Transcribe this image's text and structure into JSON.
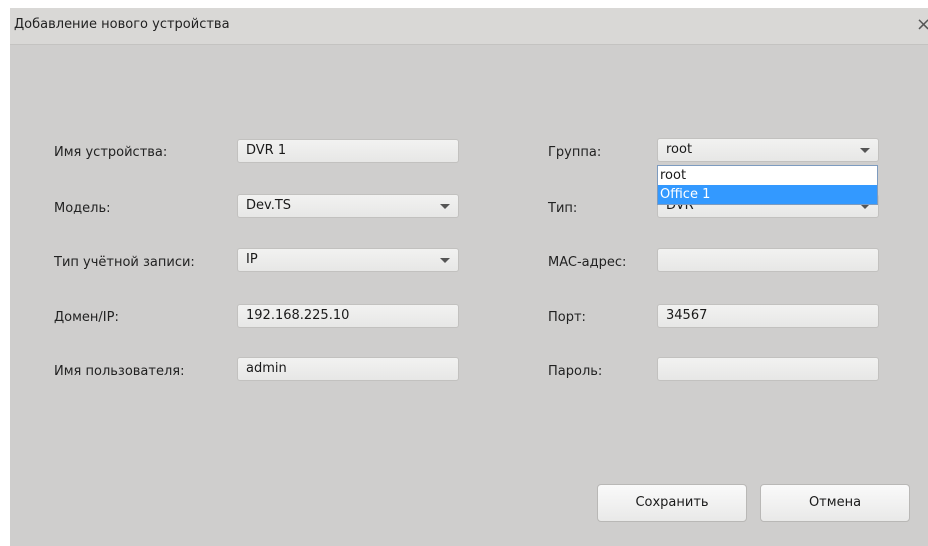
{
  "dialog": {
    "title": "Добавление нового устройства",
    "close_glyph": "×"
  },
  "left": {
    "device_name": {
      "label": "Имя устройства:",
      "value": "DVR 1"
    },
    "model": {
      "label": "Модель:",
      "value": "Dev.TS"
    },
    "account_type": {
      "label": "Тип учётной записи:",
      "value": "IP"
    },
    "domain_ip": {
      "label": "Домен/IP:",
      "value": "192.168.225.10"
    },
    "username": {
      "label": "Имя пользователя:",
      "value": "admin"
    }
  },
  "right": {
    "group": {
      "label": "Группа:",
      "value": "root",
      "options": [
        "root",
        "Office 1"
      ],
      "highlighted": "Office 1"
    },
    "type": {
      "label": "Тип:",
      "value": "DVR"
    },
    "mac": {
      "label": "MAC-адрес:",
      "value": ""
    },
    "port": {
      "label": "Порт:",
      "value": "34567"
    },
    "password": {
      "label": "Пароль:",
      "value": ""
    }
  },
  "buttons": {
    "save": "Сохранить",
    "cancel": "Отмена"
  }
}
